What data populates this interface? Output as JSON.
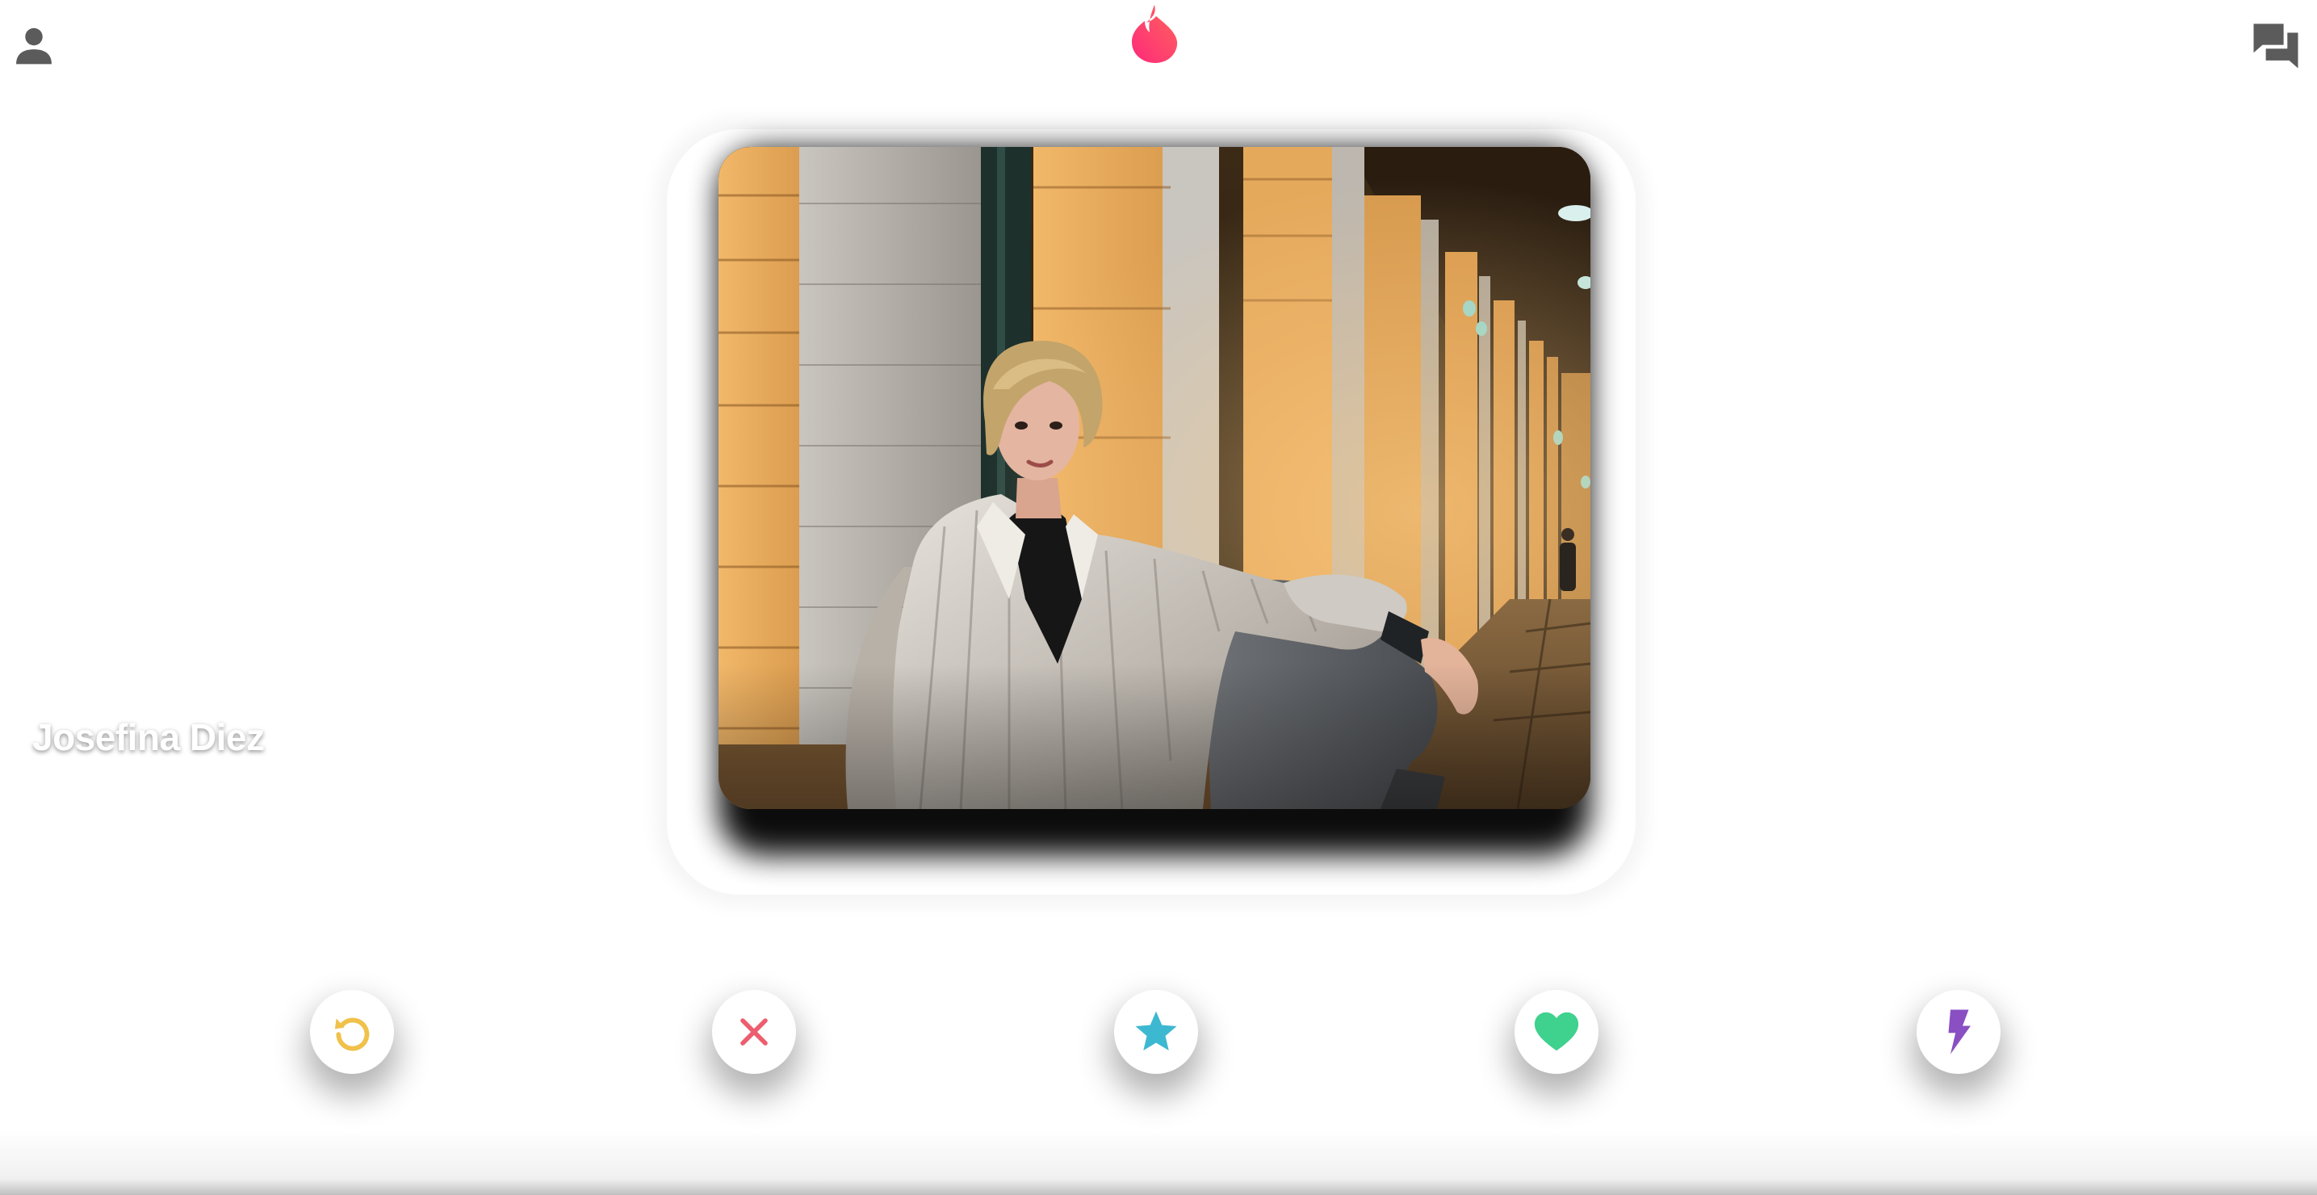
{
  "header": {
    "profile_icon": "person-icon",
    "logo_icon": "flame-icon",
    "chat_icon": "chat-bubbles-icon"
  },
  "card": {
    "name": "Josefina Diez"
  },
  "actions": [
    {
      "id": "rewind",
      "icon": "rewind-icon",
      "color": "#f0c14b"
    },
    {
      "id": "nope",
      "icon": "close-icon",
      "color": "#ec5e6f"
    },
    {
      "id": "super-like",
      "icon": "star-icon",
      "color": "#3db8d1"
    },
    {
      "id": "like",
      "icon": "heart-icon",
      "color": "#3fd18e"
    },
    {
      "id": "boost",
      "icon": "lightning-icon",
      "color": "#8a4fc2"
    }
  ],
  "colors": {
    "brand_gradient_start": "#fd297b",
    "brand_gradient_end": "#ff655b",
    "header_icon": "#5b5b5b"
  }
}
